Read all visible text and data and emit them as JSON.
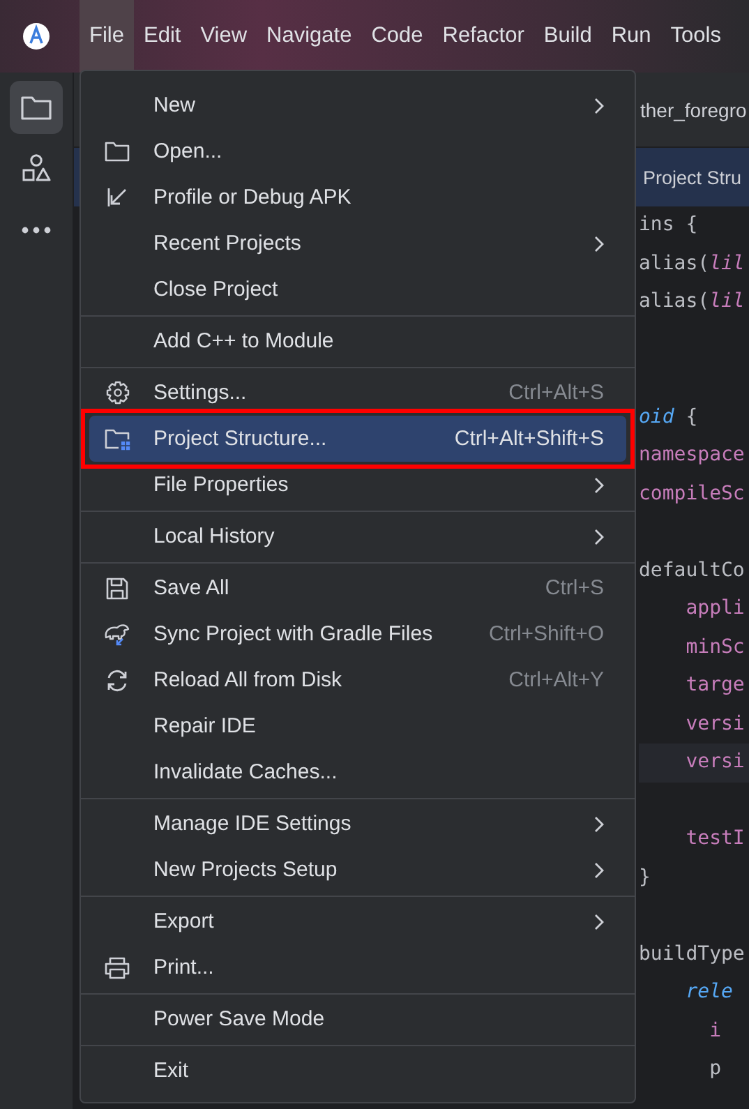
{
  "menu_bar": [
    {
      "label": "File",
      "selected": true
    },
    {
      "label": "Edit",
      "selected": false
    },
    {
      "label": "View",
      "selected": false
    },
    {
      "label": "Navigate",
      "selected": false
    },
    {
      "label": "Code",
      "selected": false
    },
    {
      "label": "Refactor",
      "selected": false
    },
    {
      "label": "Build",
      "selected": false
    },
    {
      "label": "Run",
      "selected": false
    },
    {
      "label": "Tools",
      "selected": false
    }
  ],
  "tool_window_bar": [
    {
      "selected": true
    },
    {
      "selected": false
    },
    {
      "selected": false
    }
  ],
  "editor": {
    "tab": "ther_foregro",
    "banner": "Project Stru",
    "lines": [
      {
        "kind": "code",
        "current": false,
        "segments": [
          {
            "kind": "plain",
            "text": "ins {"
          }
        ]
      },
      {
        "kind": "code",
        "current": false,
        "segments": [
          {
            "kind": "plain",
            "text": "alias("
          },
          {
            "kind": "italic",
            "text": "lil"
          }
        ]
      },
      {
        "kind": "code",
        "current": false,
        "segments": [
          {
            "kind": "plain",
            "text": "alias("
          },
          {
            "kind": "italic",
            "text": "lil"
          }
        ]
      },
      {
        "kind": "blank"
      },
      {
        "kind": "blank"
      },
      {
        "kind": "code",
        "current": false,
        "segments": [
          {
            "kind": "keyword",
            "text": "oid"
          },
          {
            "kind": "plain",
            "text": " {"
          }
        ]
      },
      {
        "kind": "code",
        "current": false,
        "segments": [
          {
            "kind": "property",
            "text": "namespace"
          }
        ]
      },
      {
        "kind": "code",
        "current": false,
        "segments": [
          {
            "kind": "property",
            "text": "compileSc"
          }
        ]
      },
      {
        "kind": "blank"
      },
      {
        "kind": "code",
        "current": false,
        "segments": [
          {
            "kind": "plain",
            "text": "defaultCo"
          }
        ]
      },
      {
        "kind": "code",
        "current": false,
        "segments": [
          {
            "kind": "property",
            "text": "    appli"
          }
        ]
      },
      {
        "kind": "code",
        "current": false,
        "segments": [
          {
            "kind": "property",
            "text": "    minSc"
          }
        ]
      },
      {
        "kind": "code",
        "current": false,
        "segments": [
          {
            "kind": "property",
            "text": "    targe"
          }
        ]
      },
      {
        "kind": "code",
        "current": false,
        "segments": [
          {
            "kind": "property",
            "text": "    versi"
          }
        ]
      },
      {
        "kind": "code",
        "current": true,
        "segments": [
          {
            "kind": "property",
            "text": "    versi"
          }
        ]
      },
      {
        "kind": "blank"
      },
      {
        "kind": "code",
        "current": false,
        "segments": [
          {
            "kind": "property",
            "text": "    testI"
          }
        ]
      },
      {
        "kind": "code",
        "current": false,
        "segments": [
          {
            "kind": "plain",
            "text": "}"
          }
        ]
      },
      {
        "kind": "blank"
      },
      {
        "kind": "code",
        "current": false,
        "segments": [
          {
            "kind": "plain",
            "text": "buildType"
          }
        ]
      },
      {
        "kind": "code",
        "current": false,
        "segments": [
          {
            "kind": "keyword",
            "text": "    rele"
          }
        ]
      },
      {
        "kind": "code",
        "current": false,
        "segments": [
          {
            "kind": "property",
            "text": "      i"
          }
        ]
      },
      {
        "kind": "code",
        "current": false,
        "segments": [
          {
            "kind": "plain",
            "text": "      p"
          }
        ]
      }
    ]
  },
  "file_menu": {
    "groups": [
      [
        {
          "label": "New",
          "submenu": true,
          "selected": false,
          "annotated": false
        },
        {
          "label": "Open...",
          "submenu": false,
          "selected": false,
          "annotated": false
        },
        {
          "label": "Profile or Debug APK",
          "submenu": false,
          "selected": false,
          "annotated": false
        },
        {
          "label": "Recent Projects",
          "submenu": true,
          "selected": false,
          "annotated": false
        },
        {
          "label": "Close Project",
          "submenu": false,
          "selected": false,
          "annotated": false
        }
      ],
      [
        {
          "label": "Add C++ to Module",
          "submenu": false,
          "selected": false,
          "annotated": false
        }
      ],
      [
        {
          "label": "Settings...",
          "shortcut": "Ctrl+Alt+S",
          "submenu": false,
          "selected": false,
          "annotated": false
        },
        {
          "label": "Project Structure...",
          "shortcut": "Ctrl+Alt+Shift+S",
          "submenu": false,
          "selected": true,
          "annotated": true
        },
        {
          "label": "File Properties",
          "submenu": true,
          "selected": false,
          "annotated": false
        }
      ],
      [
        {
          "label": "Local History",
          "submenu": true,
          "selected": false,
          "annotated": false
        }
      ],
      [
        {
          "label": "Save All",
          "shortcut": "Ctrl+S",
          "submenu": false,
          "selected": false,
          "annotated": false
        },
        {
          "label": "Sync Project with Gradle Files",
          "shortcut": "Ctrl+Shift+O",
          "submenu": false,
          "selected": false,
          "annotated": false
        },
        {
          "label": "Reload All from Disk",
          "shortcut": "Ctrl+Alt+Y",
          "submenu": false,
          "selected": false,
          "annotated": false
        },
        {
          "label": "Repair IDE",
          "submenu": false,
          "selected": false,
          "annotated": false
        },
        {
          "label": "Invalidate Caches...",
          "submenu": false,
          "selected": false,
          "annotated": false
        }
      ],
      [
        {
          "label": "Manage IDE Settings",
          "submenu": true,
          "selected": false,
          "annotated": false
        },
        {
          "label": "New Projects Setup",
          "submenu": true,
          "selected": false,
          "annotated": false
        }
      ],
      [
        {
          "label": "Export",
          "submenu": true,
          "selected": false,
          "annotated": false
        },
        {
          "label": "Print...",
          "submenu": false,
          "selected": false,
          "annotated": false
        }
      ],
      [
        {
          "label": "Power Save Mode",
          "submenu": false,
          "selected": false,
          "annotated": false
        }
      ],
      [
        {
          "label": "Exit",
          "submenu": false,
          "selected": false,
          "annotated": false
        }
      ]
    ]
  }
}
